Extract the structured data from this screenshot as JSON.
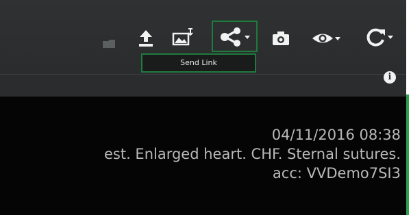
{
  "toolbar": {
    "items": [
      {
        "icon": "faded-tool-icon"
      },
      {
        "icon": "upload-icon"
      },
      {
        "icon": "image-import-icon"
      },
      {
        "icon": "share-icon",
        "has_dropdown": true,
        "active": true
      },
      {
        "icon": "camera-icon"
      },
      {
        "icon": "eye-icon",
        "has_dropdown": true
      },
      {
        "icon": "rotate-icon",
        "has_dropdown": true
      }
    ],
    "tooltip": "Send Link"
  },
  "panel": {
    "info_icon_text": "i"
  },
  "overlay": {
    "datetime": "04/11/2016 08:38",
    "description": "est. Enlarged heart. CHF. Sternal sutures.",
    "accession": "acc: VVDemo7SI3"
  },
  "colors": {
    "toolbar_bg": "#2f3132",
    "viewport_bg": "#050505",
    "highlight": "#1f7a3d",
    "accent": "#2f9e4e",
    "overlay_text": "#b9b9b9",
    "icon": "#f2f2f2"
  }
}
